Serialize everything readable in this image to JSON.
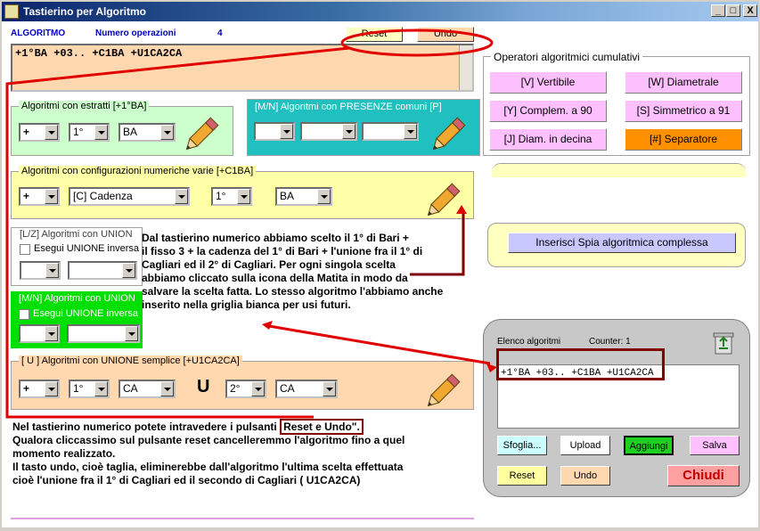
{
  "window": {
    "title": "Tastierino per Algoritmo",
    "btn_min": "_",
    "btn_max": "□",
    "btn_close": "X"
  },
  "header": {
    "algoritmo_label": "ALGORITMO",
    "num_ops_label": "Numero operazioni",
    "num_ops_value": "4",
    "reset": "Reset",
    "undo": "Undo"
  },
  "expression": "+1°BA +03.. +C1BA +U1CA2CA",
  "estratti": {
    "legend": "Algoritmi con estratti  [+1°BA]",
    "sign": "+",
    "pos": "1°",
    "ruota": "BA"
  },
  "presenze": {
    "legend": "[M/N] Algoritmi con PRESENZE comuni [P]"
  },
  "operatori": {
    "legend": "Operatori algoritmici cumulativi",
    "buttons": [
      "[V] Vertibile",
      "[W] Diametrale",
      "[Y] Complem. a 90",
      "[S] Simmetrico  a 91",
      "[J] Diam. in decina",
      "[#] Separatore"
    ]
  },
  "config": {
    "legend": "Algoritmi con configurazioni numeriche varie  [+C1BA]",
    "sign": "+",
    "tipo": "[C] Cadenza",
    "pos": "1°",
    "ruota": "BA"
  },
  "spia": {
    "button": "Inserisci Spia algoritmica complessa"
  },
  "unione_lz": {
    "legend": "[L/Z] Algoritmi con UNION",
    "check": "Esegui UNIONE inversa"
  },
  "unione_mn": {
    "legend": "[M/N] Algoritmi con UNION",
    "check": "Esegui UNIONE inversa"
  },
  "unione_semplice": {
    "legend": "[ U ] Algoritmi con UNIONE semplice  [+U1CA2CA]",
    "sign": "+",
    "pos1": "1°",
    "ruota1": "CA",
    "u": "U",
    "pos2": "2°",
    "ruota2": "CA"
  },
  "notes": {
    "note1": [
      "Dal tastierino numerico abbiamo scelto il 1° di Bari +",
      "il fisso 3 + la cadenza del 1° di Bari + l'unione fra il 1° di",
      "Cagliari  ed il 2° di Cagliari. Per ogni singola scelta",
      "abbiamo cliccato sulla icona della Matita in modo da",
      "salvare la scelta fatta. Lo stesso algoritmo l'abbiamo anche",
      "inserito nella griglia bianca per usi futuri."
    ],
    "note2_prefix": "Nel tastierino numerico potete intravedere i pulsanti",
    "note2_boxed": "Reset e Undo\".",
    "note2_rest": [
      "Qualora cliccassimo sul pulsante reset cancelleremmo l'algoritmo fino a quel",
      "momento realizzato.",
      "Il tasto undo, cioè taglia, eliminerebbe dall'algoritmo l'ultima scelta effettuata",
      "cioè l'unione fra il 1° di Cagliari ed il secondo di Cagliari ( U1CA2CA)"
    ]
  },
  "elenco": {
    "label": "Elenco algoritmi",
    "counter": "Counter: 1",
    "item": "+1°BA +03.. +C1BA +U1CA2CA",
    "sfoglia": "Sfoglia...",
    "upload": "Upload",
    "aggiungi": "Aggiungi",
    "salva": "Salva",
    "reset": "Reset",
    "undo": "Undo",
    "chiudi": "Chiudi"
  },
  "colors": {
    "annotation_red": "#e00000",
    "box_maroon": "#800000",
    "green_panel": "#ccffcc",
    "teal": "#20c0c0",
    "yellow_panel": "#ffffc0",
    "orange_panel": "#ffd8b0"
  }
}
